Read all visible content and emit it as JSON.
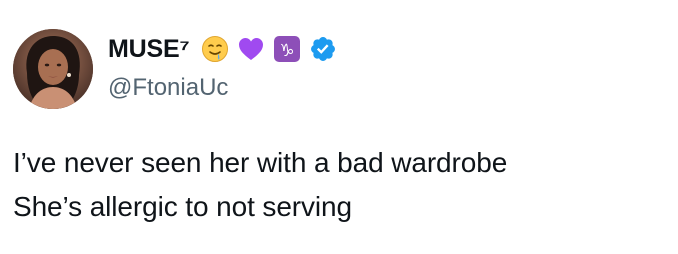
{
  "user": {
    "display_name": "MUSE⁷",
    "handle": "@FtoniaUc",
    "badge_icons": [
      "drooling-face-emoji-icon",
      "purple-heart-emoji-icon",
      "capricorn-emoji-icon",
      "verified-badge-icon"
    ],
    "colors": {
      "name": "#0f1419",
      "handle": "#536471",
      "verified": "#1d9bf0",
      "heart": "#a04af0",
      "capricorn_bg": "#8d4fb8"
    }
  },
  "tweet": {
    "lines": [
      "I’ve never seen her with a bad wardrobe",
      "She’s allergic to not serving"
    ]
  }
}
